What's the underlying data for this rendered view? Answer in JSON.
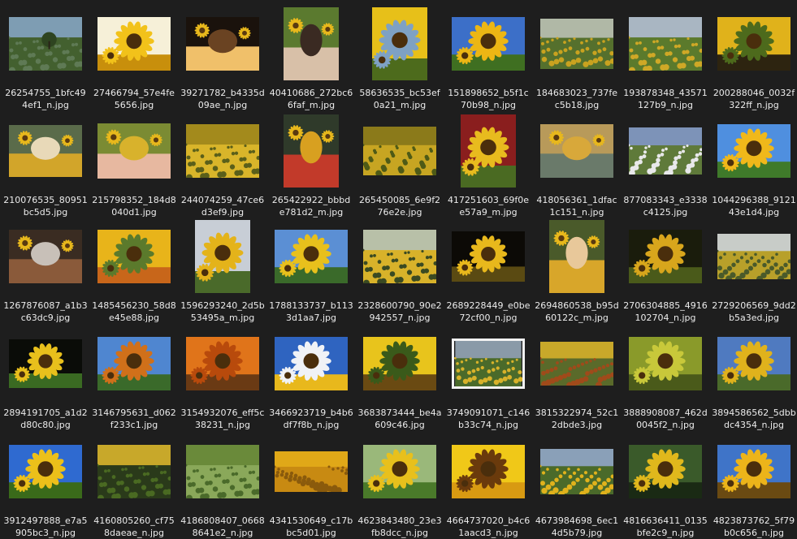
{
  "files": [
    {
      "name_l1": "26254755_1bfc49",
      "name_l2": "4ef1_n.jpg",
      "subject": "meadow-tree-landscape",
      "colors": [
        "#7e9db3",
        "#5f7a55",
        "#43602f"
      ]
    },
    {
      "name_l1": "27466794_57e4fe",
      "name_l2": "5656.jpg",
      "subject": "sunflower-closeup-white-bg",
      "colors": [
        "#f6f0d8",
        "#f2c21a",
        "#c88f0c"
      ]
    },
    {
      "name_l1": "39271782_b4335d",
      "name_l2": "09ae_n.jpg",
      "subject": "candles-sunflowers-dark",
      "colors": [
        "#1a120c",
        "#6a4322",
        "#f0c06a"
      ]
    },
    {
      "name_l1": "40410686_272bc6",
      "name_l2": "6faf_m.jpg",
      "subject": "woman-child-sunflowers",
      "colors": [
        "#5b7a2f",
        "#3a2a22",
        "#d8c0a8"
      ]
    },
    {
      "name_l1": "58636535_bc53ef",
      "name_l2": "0a21_m.jpg",
      "subject": "sunflowers-blue-sky",
      "colors": [
        "#e7c019",
        "#7ea1c4",
        "#4d6b1c"
      ]
    },
    {
      "name_l1": "151898652_b5f1c",
      "name_l2": "70b98_n.jpg",
      "subject": "sunflower-blue-sky",
      "colors": [
        "#3c6fc8",
        "#ecb614",
        "#3f6f21"
      ]
    },
    {
      "name_l1": "184683023_737fe",
      "name_l2": "c5b18.jpg",
      "subject": "sunflower-field",
      "colors": [
        "#b0b8a6",
        "#c9a21f",
        "#55702d"
      ]
    },
    {
      "name_l1": "193878348_43571",
      "name_l2": "127b9_n.jpg",
      "subject": "sunflower-field-people",
      "colors": [
        "#a9b6c2",
        "#cfa826",
        "#5b7a2c"
      ]
    },
    {
      "name_l1": "200288046_0032f",
      "name_l2": "322ff_n.jpg",
      "subject": "sunflower-cluster",
      "colors": [
        "#e0b21b",
        "#4d6a1c",
        "#2d2410"
      ]
    },
    {
      "name_l1": "210076535_80951",
      "name_l2": "bc5d5.jpg",
      "subject": "market-sunflower-buckets",
      "colors": [
        "#5a6b4a",
        "#e8d9b8",
        "#d2a52a"
      ]
    },
    {
      "name_l1": "215798352_184d8",
      "name_l2": "040d1.jpg",
      "subject": "girl-in-sunflowers",
      "colors": [
        "#7b8b33",
        "#d8b22c",
        "#e7b8a0"
      ]
    },
    {
      "name_l1": "244074259_47ce6",
      "name_l2": "d3ef9.jpg",
      "subject": "sunflower-field-dense",
      "colors": [
        "#a38a1c",
        "#5a5f1a",
        "#d9b52a"
      ]
    },
    {
      "name_l1": "265422922_bbbd",
      "name_l2": "e781d2_m.jpg",
      "subject": "flower-bouquet",
      "colors": [
        "#2f3a2a",
        "#d8a020",
        "#c23a2a"
      ]
    },
    {
      "name_l1": "265450085_6e9f2",
      "name_l2": "76e2e.jpg",
      "subject": "sunflower-field-dense",
      "colors": [
        "#8b7a1a",
        "#4e5a16",
        "#c7a522"
      ]
    },
    {
      "name_l1": "417251603_69f0e",
      "name_l2": "e57a9_m.jpg",
      "subject": "sunflowers-red-wall",
      "colors": [
        "#8a1e1e",
        "#e8bb1e",
        "#4a6a22"
      ]
    },
    {
      "name_l1": "418056361_1dfac",
      "name_l2": "1c151_n.jpg",
      "subject": "sunflower-painting",
      "colors": [
        "#b89a5a",
        "#d8a83a",
        "#6a7a6a"
      ]
    },
    {
      "name_l1": "877083343_e3338",
      "name_l2": "c4125.jpg",
      "subject": "field-mountains",
      "colors": [
        "#7d93b8",
        "#e8e8ea",
        "#5f7a3a"
      ]
    },
    {
      "name_l1": "1044296388_9121",
      "name_l2": "43e1d4.jpg",
      "subject": "sunflower-blue-sky",
      "colors": [
        "#4f8fdf",
        "#f0b81a",
        "#3f7a2a"
      ]
    },
    {
      "name_l1": "1267876087_a1b3",
      "name_l2": "c63dc9.jpg",
      "subject": "kitchen-table",
      "colors": [
        "#3a2c22",
        "#c8c0b8",
        "#8a5a3a"
      ]
    },
    {
      "name_l1": "1485456230_58d8",
      "name_l2": "e45e88.jpg",
      "subject": "sunflower-butterfly",
      "colors": [
        "#e8b41a",
        "#5b7a2c",
        "#c8661a"
      ]
    },
    {
      "name_l1": "1596293240_2d5b",
      "name_l2": "53495a_m.jpg",
      "subject": "sunflower-cloudy-sky",
      "colors": [
        "#c8ced6",
        "#e4b31a",
        "#4a6a2a"
      ]
    },
    {
      "name_l1": "1788133737_b113",
      "name_l2": "3d1aa7.jpg",
      "subject": "tall-sunflowers-sky",
      "colors": [
        "#5b8fd4",
        "#e8c01c",
        "#3a6a2a"
      ]
    },
    {
      "name_l1": "2328600790_90e2",
      "name_l2": "942557_n.jpg",
      "subject": "sunflower-field-dusk",
      "colors": [
        "#b8c0a8",
        "#3a4a22",
        "#d8b22a"
      ]
    },
    {
      "name_l1": "2689228449_e0be",
      "name_l2": "72cf00_n.jpg",
      "subject": "sunflowers-black-bg",
      "colors": [
        "#0c0a06",
        "#e8b81c",
        "#5a4a12"
      ]
    },
    {
      "name_l1": "2694860538_b95d",
      "name_l2": "60122c_m.jpg",
      "subject": "girl-portrait-sunflower",
      "colors": [
        "#4a5a2a",
        "#e8c89a",
        "#d8a62a"
      ]
    },
    {
      "name_l1": "2706304885_4916",
      "name_l2": "102704_n.jpg",
      "subject": "sunflowers-dark",
      "colors": [
        "#1a1c0c",
        "#d8a61c",
        "#4a5a1a"
      ]
    },
    {
      "name_l1": "2729206569_9dd2",
      "name_l2": "b5a3ed.jpg",
      "subject": "field-horizon",
      "colors": [
        "#c8ccc8",
        "#4a5a2a",
        "#b8a02a"
      ]
    },
    {
      "name_l1": "2894191705_a1d2",
      "name_l2": "d80c80.jpg",
      "subject": "sunflower-dark-bg",
      "colors": [
        "#0a0c08",
        "#e8c01c",
        "#3a6a22"
      ]
    },
    {
      "name_l1": "3146795631_d062",
      "name_l2": "f233c1.jpg",
      "subject": "orange-sunflowers-sky",
      "colors": [
        "#4f86d0",
        "#d0701a",
        "#3a6a2a"
      ]
    },
    {
      "name_l1": "3154932076_eff5c",
      "name_l2": "38231_n.jpg",
      "subject": "orange-sunflower-closeup",
      "colors": [
        "#e0741a",
        "#b84a0c",
        "#6a3a14"
      ]
    },
    {
      "name_l1": "3466923719_b4b6",
      "name_l2": "df7f8b_n.jpg",
      "subject": "sunflowers-clouds",
      "colors": [
        "#2f64c0",
        "#f0f2f6",
        "#e8b81c"
      ]
    },
    {
      "name_l1": "3683873444_be4a",
      "name_l2": "609c46.jpg",
      "subject": "sunflowers-closeup",
      "colors": [
        "#e8c41c",
        "#3a5a1a",
        "#6a4a12"
      ]
    },
    {
      "name_l1": "3749091071_c146",
      "name_l2": "b33c74_n.jpg",
      "subject": "field-white-frame",
      "colors": [
        "#8a9aa8",
        "#d8b22a",
        "#4a6a2a"
      ]
    },
    {
      "name_l1": "3815322974_52c1",
      "name_l2": "2dbde3.jpg",
      "subject": "sunflower-field-person",
      "colors": [
        "#c8a82a",
        "#a04a1a",
        "#5a6a2a"
      ]
    },
    {
      "name_l1": "3888908087_462d",
      "name_l2": "0045f2_n.jpg",
      "subject": "sunflower-bud-green",
      "colors": [
        "#8a9a2a",
        "#c8c83a",
        "#4a5a1a"
      ]
    },
    {
      "name_l1": "3894586562_5dbb",
      "name_l2": "dc4354_n.jpg",
      "subject": "sunflowers-blue-sky",
      "colors": [
        "#4f7ac0",
        "#e0b21c",
        "#4a6a2a"
      ]
    },
    {
      "name_l1": "3912497888_e7a5",
      "name_l2": "905bc3_n.jpg",
      "subject": "sunflower-blue-sky",
      "colors": [
        "#2f6ad0",
        "#ecc01a",
        "#3a6a1a"
      ]
    },
    {
      "name_l1": "4160805260_cf75",
      "name_l2": "8daeae_n.jpg",
      "subject": "sunflower-field",
      "colors": [
        "#c8a82a",
        "#4a6a22",
        "#2a3a1a"
      ]
    },
    {
      "name_l1": "4186808407_0668",
      "name_l2": "8641e2_n.jpg",
      "subject": "green-field",
      "colors": [
        "#6a8a3a",
        "#4a6a2a",
        "#8aa85a"
      ]
    },
    {
      "name_l1": "4341530649_c17b",
      "name_l2": "bc5d01.jpg",
      "subject": "sunflower-rows",
      "colors": [
        "#e0a818",
        "#8a5a0c",
        "#c88a12"
      ]
    },
    {
      "name_l1": "4623843480_23e3",
      "name_l2": "fb8dcc_n.jpg",
      "subject": "sunflower-green-leaves",
      "colors": [
        "#9ab87a",
        "#e8c01c",
        "#4a7a2a"
      ]
    },
    {
      "name_l1": "4664737020_b4c6",
      "name_l2": "1aacd3_n.jpg",
      "subject": "sunflower-closeup",
      "colors": [
        "#f0c818",
        "#6a3a0c",
        "#d89a12"
      ]
    },
    {
      "name_l1": "4673984698_6ec1",
      "name_l2": "4d5b79.jpg",
      "subject": "sunflower-landscape",
      "colors": [
        "#8aa0b8",
        "#e0b21c",
        "#4a6a2a"
      ]
    },
    {
      "name_l1": "4816636411_0135",
      "name_l2": "bfe2c9_n.jpg",
      "subject": "sunflowers-green",
      "colors": [
        "#3a5a2a",
        "#e0b81c",
        "#1a2a14"
      ]
    },
    {
      "name_l1": "4823873762_5f79",
      "name_l2": "b0c656_n.jpg",
      "subject": "sunflower-blue-sky",
      "colors": [
        "#3f74c8",
        "#ecb41a",
        "#6a4a12"
      ]
    }
  ]
}
